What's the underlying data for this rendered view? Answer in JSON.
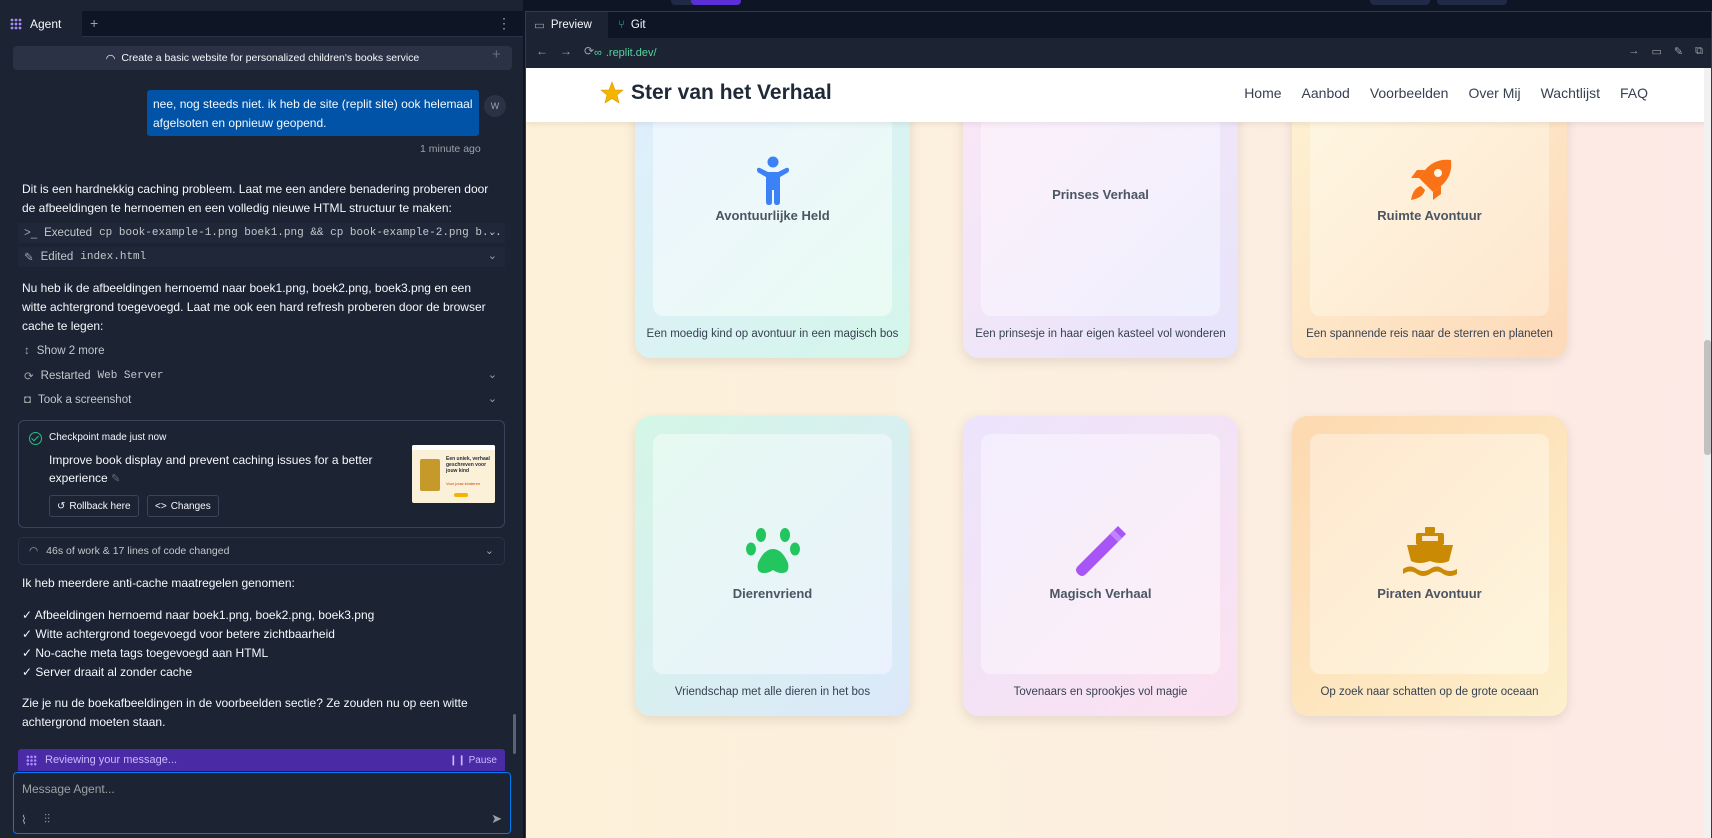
{
  "agent_panel": {
    "tab_label": "Agent",
    "thread_title": "Create a basic website for personalized children's books service",
    "user_message": "nee, nog steeds niet. ik heb de site (replit site) ook helemaal afgelsoten en opnieuw geopend.",
    "user_avatar": "W",
    "message_time": "1 minute ago",
    "reply_1": "Dit is een hardnekkig caching probleem. Laat me een andere benadering proberen door de afbeeldingen te hernoemen en een volledig nieuwe HTML structuur te maken:",
    "executed_label": "Executed",
    "executed_cmd": "cp book-example-1.png boek1.png && cp book-example-2.png b...",
    "edited_label": "Edited",
    "edited_file": "index.html",
    "reply_2": "Nu heb ik de afbeeldingen hernoemd naar boek1.png, boek2.png, boek3.png en een witte achtergrond toegevoegd. Laat me ook een hard refresh proberen door de browser cache te legen:",
    "show_more": "Show 2 more",
    "restarted_label": "Restarted",
    "restarted_target": "Web Server",
    "screenshot_label": "Took a screenshot",
    "checkpoint": {
      "title": "Checkpoint made just now",
      "description": "Improve book display and prevent caching issues for a better experience",
      "rollback": "Rollback here",
      "changes": "Changes",
      "thumb_heading": "Een uniek, verhaal geschreven voor jouw kind",
      "thumb_sub": "Voor jouw kinderen"
    },
    "work_summary": "46s of work & 17 lines of code changed",
    "reply_3": "Ik heb meerdere anti-cache maatregelen genomen:",
    "bullets": [
      "✓ Afbeeldingen hernoemd naar boek1.png, boek2.png, boek3.png",
      "✓ Witte achtergrond toegevoegd voor betere zichtbaarheid",
      "✓ No-cache meta tags toegevoegd aan HTML",
      "✓ Server draait al zonder cache"
    ],
    "reply_4": "Zie je nu de boekafbeeldingen in de voorbeelden sectie? Ze zouden nu op een witte achtergrond moeten staan.",
    "reviewing": "Reviewing your message...",
    "pause": "Pause",
    "input_placeholder": "Message Agent..."
  },
  "preview_panel": {
    "tabs": [
      "Preview",
      "Git"
    ],
    "url": ".replit.dev/"
  },
  "website": {
    "brand": "Ster van het Verhaal",
    "nav": [
      "Home",
      "Aanbod",
      "Voorbeelden",
      "Over Mij",
      "Wachtlijst",
      "FAQ"
    ],
    "cards": [
      {
        "title": "Avontuurlijke Held",
        "description": "Een moedig kind op avontuur in een magisch bos",
        "icon": "child-icon",
        "icon_color": "#3b82f6"
      },
      {
        "title": "Prinses Verhaal",
        "description": "Een prinsesje in haar eigen kasteel vol wonderen",
        "icon": "",
        "icon_color": ""
      },
      {
        "title": "Ruimte Avontuur",
        "description": "Een spannende reis naar de sterren en planeten",
        "icon": "rocket-icon",
        "icon_color": "#f97316"
      },
      {
        "title": "Dierenvriend",
        "description": "Vriendschap met alle dieren in het bos",
        "icon": "paw-icon",
        "icon_color": "#22c55e"
      },
      {
        "title": "Magisch Verhaal",
        "description": "Tovenaars en sprookjes vol magie",
        "icon": "magic-wand-icon",
        "icon_color": "#a855f7"
      },
      {
        "title": "Piraten Avontuur",
        "description": "Op zoek naar schatten op de grote oceaan",
        "icon": "ship-icon",
        "icon_color": "#ca8a04"
      }
    ]
  },
  "colors": {
    "agent_bg": "#1c2333",
    "user_bubble": "#0053a6",
    "accent_blue": "#0079f2",
    "reviewing_bar": "#4b2aa6",
    "star": "#f5b400"
  }
}
